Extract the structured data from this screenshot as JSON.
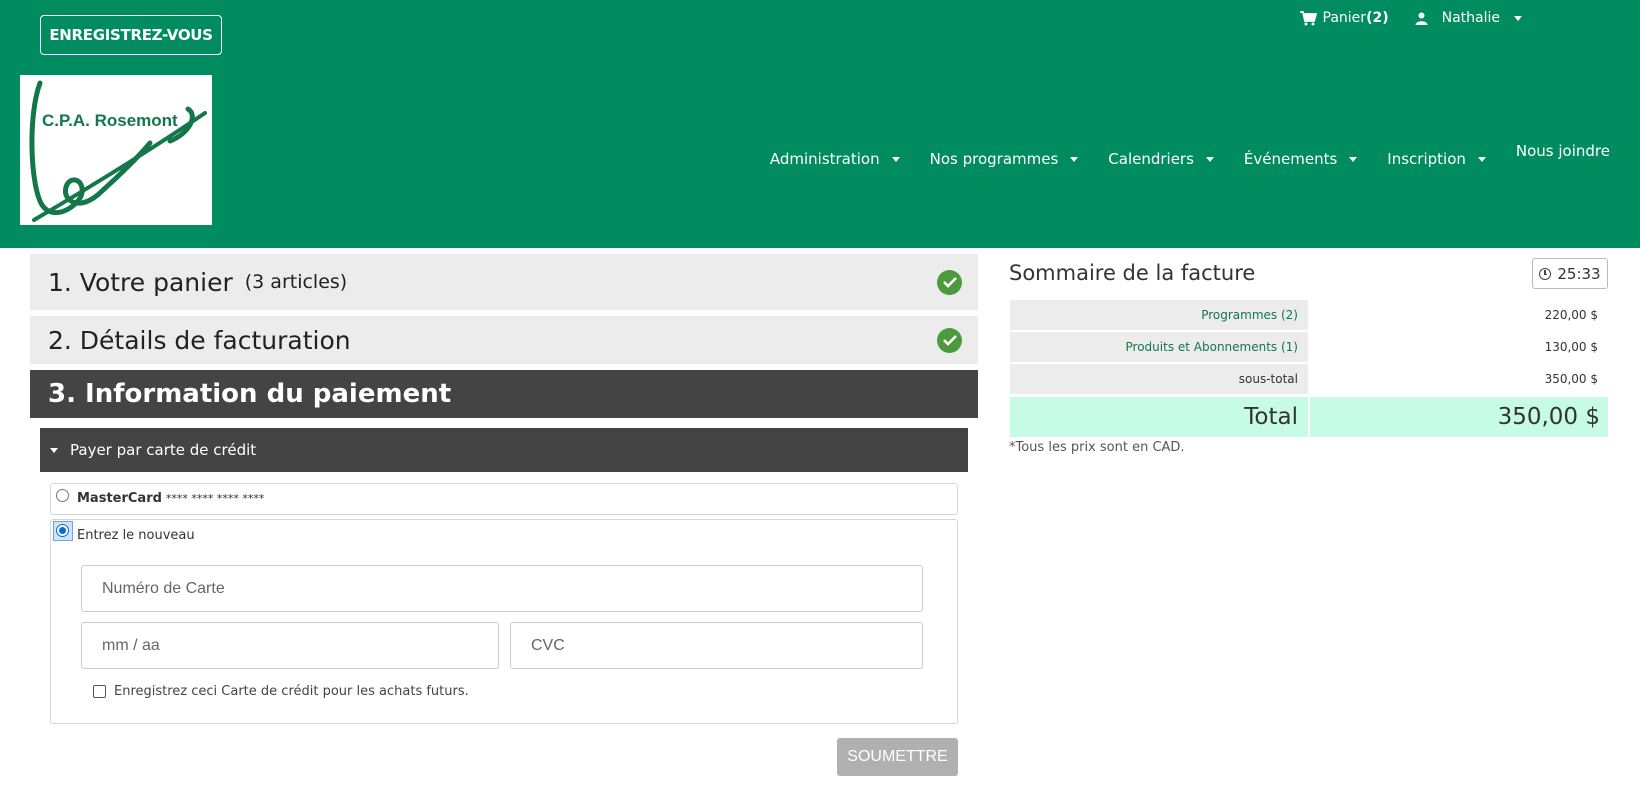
{
  "header": {
    "register_label": "ENREGISTREZ-VOUS",
    "cart_label": "Panier",
    "cart_count": "(2)",
    "user_name": "Nathalie",
    "logo_text": "C.P.A. Rosemont",
    "nav": [
      {
        "label": "Administration"
      },
      {
        "label": "Nos programmes"
      },
      {
        "label": "Calendriers"
      },
      {
        "label": "Événements"
      },
      {
        "label": "Inscription"
      },
      {
        "label": "Nous joindre"
      }
    ],
    "colors": {
      "brand": "#008c5f",
      "white": "#ffffff"
    }
  },
  "steps": [
    {
      "title": "1. Votre panier",
      "subtitle": "(3 articles)",
      "status": "complete"
    },
    {
      "title": "2. Détails de facturation",
      "status": "complete"
    },
    {
      "title": "3. Information du paiement",
      "status": "active"
    }
  ],
  "payment": {
    "section_label": "Payer par carte de crédit",
    "saved_card": {
      "brand": "MasterCard",
      "masked": "**** **** **** ****",
      "selected": false
    },
    "new_card": {
      "label": "Entrez le nouveau",
      "selected": true
    },
    "card_number_placeholder": "Numéro de Carte",
    "expiry_placeholder": "mm / aa",
    "cvc_placeholder": "CVC",
    "save_card_label": "Enregistrez ceci Carte de crédit pour les achats futurs.",
    "submit_label": "SOUMETTRE"
  },
  "summary": {
    "title": "Sommaire de la facture",
    "timer": "25:33",
    "rows": [
      {
        "label": "Programmes (2)",
        "value": "220,00 $"
      },
      {
        "label": "Produits et Abonnements (1)",
        "value": "130,00 $"
      },
      {
        "label": "sous-total",
        "value": "350,00 $"
      }
    ],
    "total_label": "Total",
    "total_value": "350,00 $",
    "note": "*Tous les prix sont en CAD.",
    "colors": {
      "total_bg": "#c6fbe5",
      "row_bg": "#ececec",
      "link": "#13774a"
    }
  }
}
